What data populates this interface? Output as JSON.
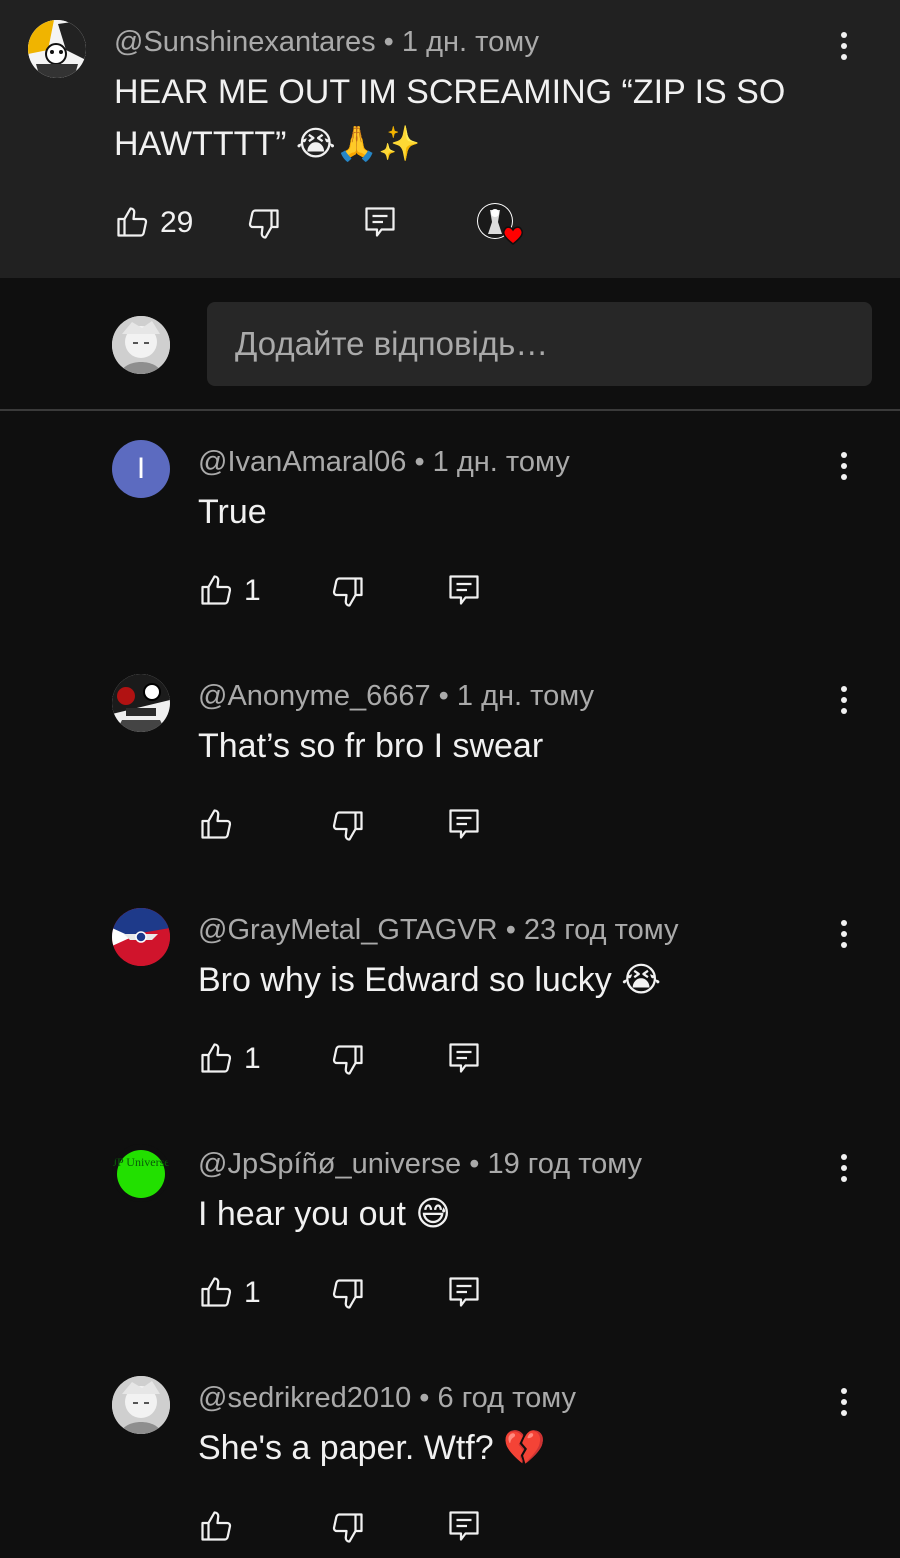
{
  "parent_comment": {
    "author": "@Sunshinexantares",
    "time": "1 дн. тому",
    "text_line1": "HEAR ME OUT IM SCREAMING “ZIP IS SO",
    "text_line2": "HAWTTTT”",
    "emoji": "😭🙏✨",
    "likes": "29",
    "creator_heart": true
  },
  "reply_input": {
    "placeholder": "Додайте відповідь…"
  },
  "replies": [
    {
      "author": "@IvanAmaral06",
      "time": "1 дн. тому",
      "text": "True",
      "emoji": "",
      "likes": "1",
      "avatar_letter": "I",
      "avatar_color": "#5c6bc0"
    },
    {
      "author": "@Anonyme_6667",
      "time": "1 дн. тому",
      "text": "That’s so fr bro I swear",
      "emoji": "",
      "likes": ""
    },
    {
      "author": "@GrayMetal_GTAGVR",
      "time": "23 год тому",
      "text": "Bro why is Edward so lucky",
      "emoji": "😭",
      "likes": "1"
    },
    {
      "author": "@JpSpíñø_universe",
      "time": "19 год тому",
      "text": "I hear you out",
      "emoji": "😅",
      "likes": "1",
      "avatar_text": "JP Universe",
      "avatar_color": "#22e000"
    },
    {
      "author": "@sedrikred2010",
      "time": "6 год тому",
      "text": "She's a paper. Wtf?",
      "emoji": "💔",
      "likes": ""
    }
  ],
  "icons": {
    "like": "thumbs-up-icon",
    "dislike": "thumbs-down-icon",
    "reply": "reply-comment-icon",
    "more": "more-vert-icon",
    "heart": "creator-heart-icon"
  },
  "colors": {
    "background": "#0f0f0f",
    "parent_background": "#212121",
    "meta_text": "#aaaaaa",
    "heart": "#ff0000"
  }
}
